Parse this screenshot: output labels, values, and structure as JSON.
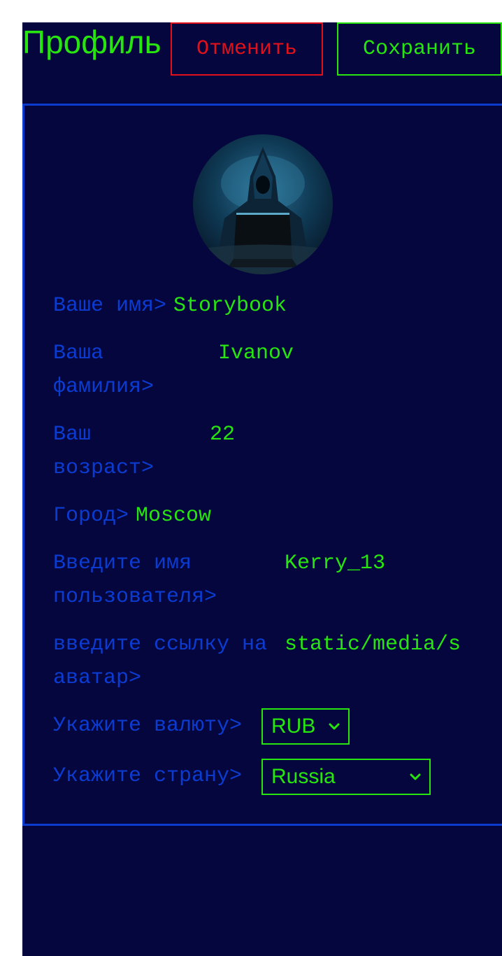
{
  "header": {
    "title": "Профиль",
    "cancel_label": "Отменить",
    "save_label": "Сохранить"
  },
  "profile": {
    "avatar_icon": "hacker-avatar-image",
    "fields": {
      "first_name": {
        "label": "Ваше имя>",
        "value": "Storybook"
      },
      "last_name": {
        "label": "Ваша фамилия>",
        "value": "Ivanov"
      },
      "age": {
        "label": "Ваш возраст>",
        "value": "22"
      },
      "city": {
        "label": "Город>",
        "value": "Moscow"
      },
      "username": {
        "label": "Введите имя пользователя>",
        "value": "Kerry_13"
      },
      "avatar_link": {
        "label": "введите ссылку на аватар>",
        "value": "static/media/s"
      }
    },
    "currency": {
      "label": "Укажите валюту>",
      "value": "RUB"
    },
    "country": {
      "label": "Укажите страну>",
      "value": "Russia"
    }
  },
  "colors": {
    "background": "#06063f",
    "accent_green": "#27e60f",
    "label_blue": "#0b3bcf",
    "cancel_red": "#e0111a"
  }
}
